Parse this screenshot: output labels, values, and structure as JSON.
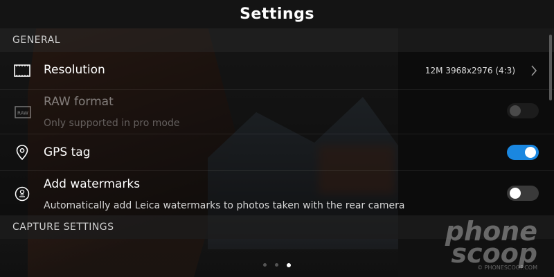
{
  "header": {
    "title": "Settings"
  },
  "sections": {
    "general": "GENERAL",
    "capture": "CAPTURE SETTINGS"
  },
  "settings": {
    "resolution": {
      "label": "Resolution",
      "value": "12M 3968x2976 (4:3)"
    },
    "raw": {
      "label": "RAW format",
      "icon_text": "RAW",
      "sub": "Only supported in pro mode",
      "state": "disabled"
    },
    "gps": {
      "label": "GPS tag",
      "state": "on"
    },
    "watermarks": {
      "label": "Add watermarks",
      "sub": "Automatically add Leica watermarks to photos taken with the rear camera",
      "state": "off"
    }
  },
  "pager": {
    "count": 3,
    "active": 3
  },
  "watermark": {
    "line1": "phone",
    "line2": "scoop",
    "foot": "© PHONESCOOP.COM"
  },
  "colors": {
    "toggle_on": "#1a87e0",
    "background": "#141414"
  }
}
